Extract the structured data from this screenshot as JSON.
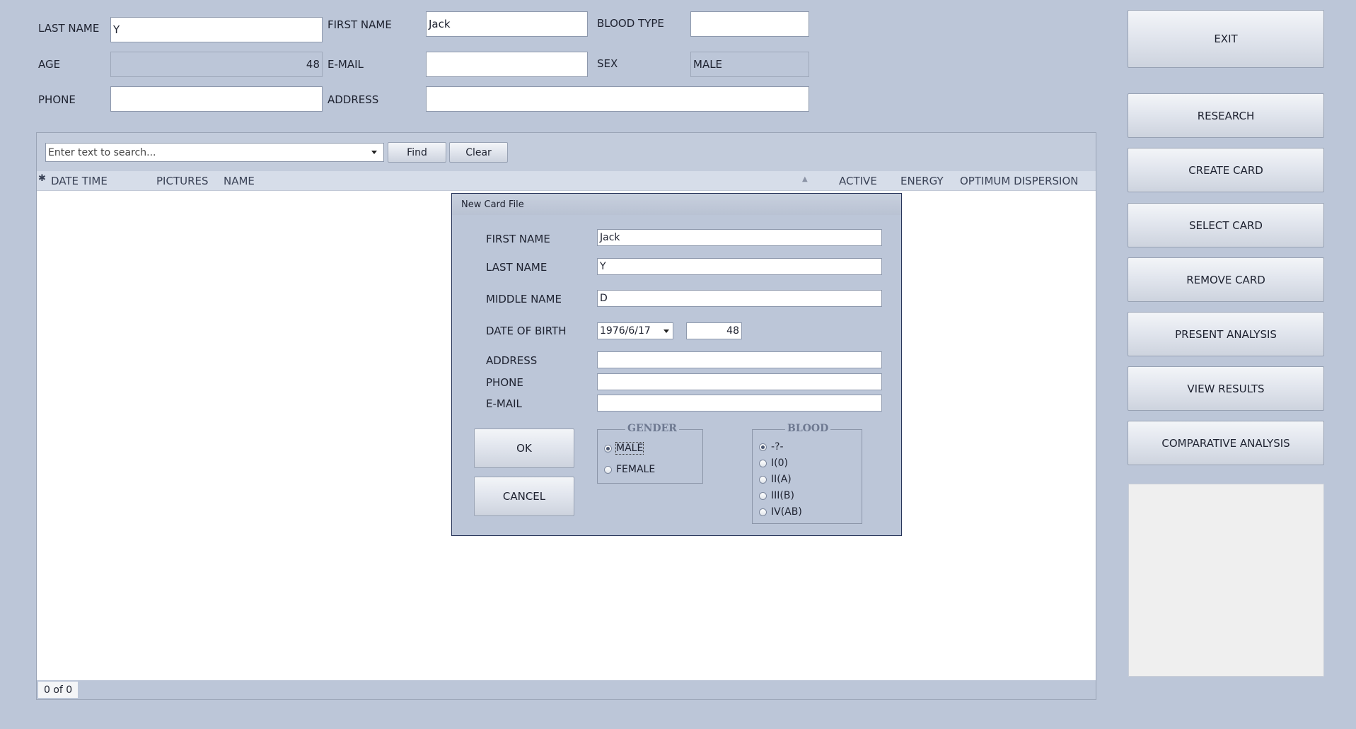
{
  "patient": {
    "last_name_label": "LAST NAME",
    "last_name": "Y",
    "first_name_label": "FIRST NAME",
    "first_name": "Jack",
    "blood_type_label": "BLOOD TYPE",
    "blood_type": "",
    "age_label": "AGE",
    "age": "48",
    "email_label": "E-MAIL",
    "email": "",
    "sex_label": "SEX",
    "sex": "MALE",
    "phone_label": "PHONE",
    "phone": "",
    "address_label": "ADDRESS",
    "address": ""
  },
  "sidebar": {
    "exit": "EXIT",
    "research": "RESEARCH",
    "create_card": "CREATE CARD",
    "select_card": "SELECT CARD",
    "remove_card": "REMOVE CARD",
    "present_analysis": "PRESENT ANALYSIS",
    "view_results": "VIEW RESULTS",
    "comparative_analysis": "COMPARATIVE ANALYSIS"
  },
  "grid": {
    "search_placeholder": "Enter text to search...",
    "find": "Find",
    "clear": "Clear",
    "columns": [
      "DATE TIME",
      "PICTURES",
      "NAME",
      "ACTIVE",
      "ENERGY",
      "OPTIMUM DISPERSION"
    ],
    "pager": "0 of 0"
  },
  "dialog": {
    "title": "New Card File",
    "first_name_label": "FIRST NAME",
    "first_name": "Jack",
    "last_name_label": "LAST NAME",
    "last_name": "Y",
    "middle_name_label": "MIDDLE NAME",
    "middle_name": "D",
    "dob_label": "DATE OF BIRTH",
    "dob": "1976/6/17",
    "age": "48",
    "address_label": "ADDRESS",
    "address": "",
    "phone_label": "PHONE",
    "phone": "",
    "email_label": "E-MAIL",
    "email": "",
    "ok": "OK",
    "cancel": "CANCEL",
    "gender_title": "GENDER",
    "gender_options": [
      "MALE",
      "FEMALE"
    ],
    "gender_selected": "MALE",
    "blood_title": "BLOOD",
    "blood_options": [
      "-?-",
      "I(0)",
      "II(A)",
      "III(B)",
      "IV(AB)"
    ],
    "blood_selected": "-?-"
  },
  "icons": {
    "asterisk": "asterisk-icon",
    "sort": "sort-asc-icon",
    "dropdown": "chevron-down-icon"
  }
}
